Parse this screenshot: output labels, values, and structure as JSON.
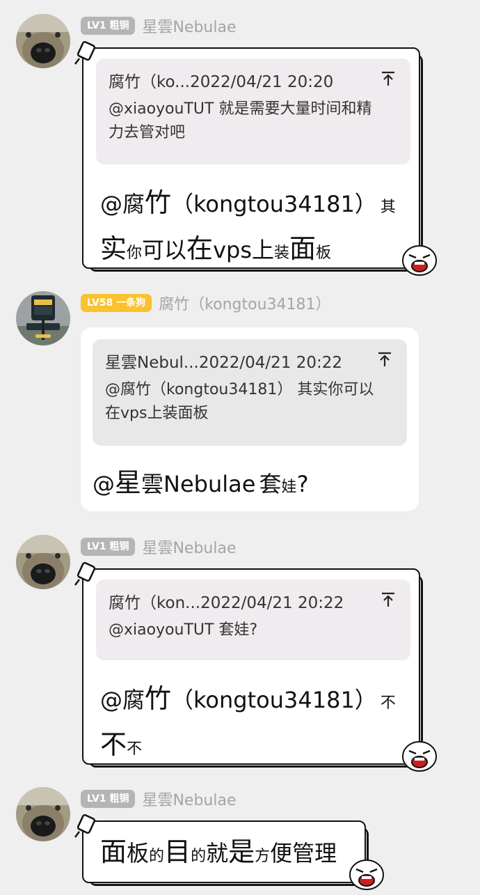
{
  "messages": [
    {
      "level": "LV1 粗铜",
      "username": "星雲Nebulae",
      "quote_header": "腐竹（ko...2022/04/21 20:20",
      "quote_body_1": "@xiaoyouTUT 就是需要大量时间和精",
      "quote_body_2": "力去管对吧",
      "text": {
        "mention": "@腐",
        "big1": "竹",
        "paren": "（kongtou34181）",
        "qi": "其",
        "shi": "实",
        "ni": "你",
        "keyi": "可以",
        "zai": "在",
        "vps": "vps",
        "shang": "上",
        "zhuang": "装",
        "mian": "面",
        "ban": "板"
      }
    },
    {
      "level": "LV58 一条狗",
      "username": "腐竹（kongtou34181）",
      "quote_header": "星雲Nebul...2022/04/21 20:22",
      "quote_body_1": "@腐竹（kongtou34181） 其实你可以",
      "quote_body_2": "在vps上装面板",
      "text": {
        "at": "@",
        "xing": "星",
        "yun": "雲",
        "neb": "Nebulae",
        "tao": "套",
        "wa": "娃",
        "q": "?"
      }
    },
    {
      "level": "LV1 粗铜",
      "username": "星雲Nebulae",
      "quote_header": "腐竹（kon...2022/04/21 20:22",
      "quote_body_1": "@xiaoyouTUT 套娃?",
      "text": {
        "mention": "@腐",
        "big1": "竹",
        "paren": "（kongtou34181）",
        "bu1": "不",
        "bu2": "不",
        "bu3": "不"
      }
    },
    {
      "level": "LV1 粗铜",
      "username": "星雲Nebulae",
      "text": {
        "mian": "面",
        "ban": "板",
        "de1": "的",
        "mu": "目",
        "de2": "的",
        "jiu": "就",
        "shi": "是",
        "fang": "方",
        "bian": "便",
        "guanli": "管理"
      }
    }
  ],
  "icons": {
    "pin_to_top": "⊤"
  },
  "colors": {
    "bg": "#efefef",
    "badge_gray": "#b5b5b5",
    "badge_yellow": "#f9c22e",
    "username": "#a5a5a5"
  }
}
